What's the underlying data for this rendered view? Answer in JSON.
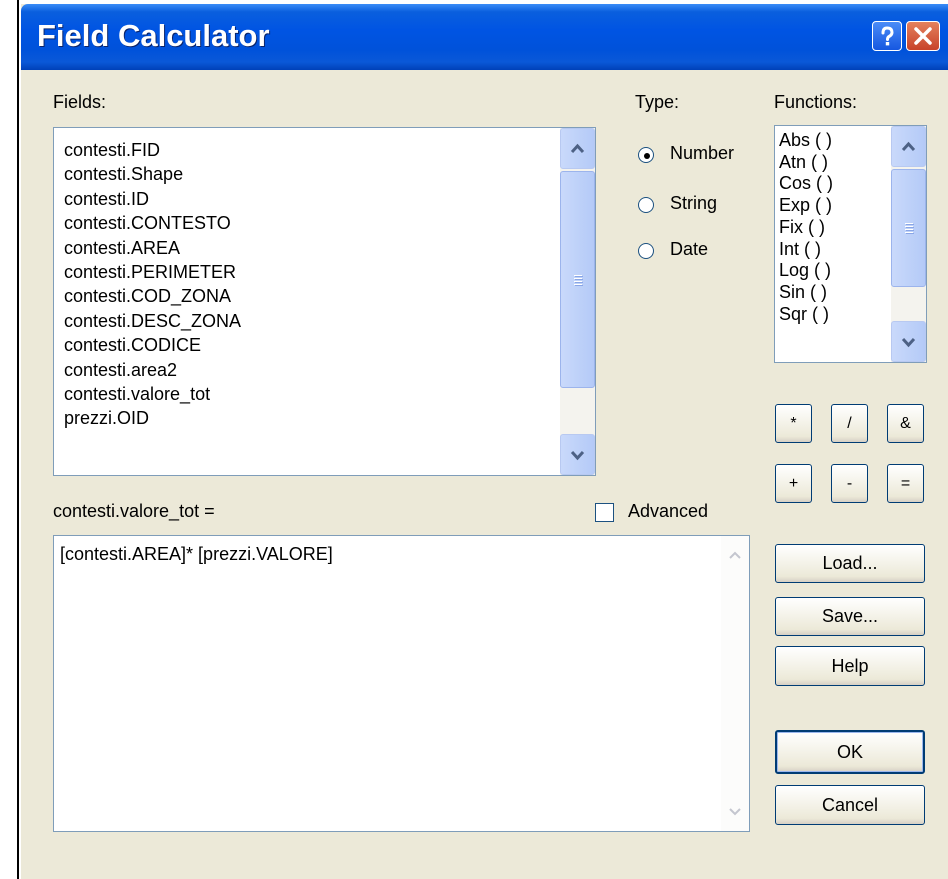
{
  "window": {
    "title": "Field Calculator"
  },
  "fields": {
    "label": "Fields:",
    "items": [
      "contesti.FID",
      "contesti.Shape",
      "contesti.ID",
      "contesti.CONTESTO",
      "contesti.AREA",
      "contesti.PERIMETER",
      "contesti.COD_ZONA",
      "contesti.DESC_ZONA",
      "contesti.CODICE",
      "contesti.area2",
      "contesti.valore_tot",
      "prezzi.OID"
    ]
  },
  "type": {
    "label": "Type:",
    "options": [
      "Number",
      "String",
      "Date"
    ],
    "selected": "Number"
  },
  "functions": {
    "label": "Functions:",
    "items": [
      "Abs ( )",
      "Atn ( )",
      "Cos ( )",
      "Exp ( )",
      "Fix ( )",
      "Int ( )",
      "Log ( )",
      "Sin ( )",
      "Sqr ( )"
    ]
  },
  "operators": [
    "*",
    "/",
    "&",
    "+",
    "-",
    "="
  ],
  "expression": {
    "label": "contesti.valore_tot =",
    "value": "[contesti.AREA]* [prezzi.VALORE]"
  },
  "advanced": {
    "label": "Advanced",
    "checked": false
  },
  "buttons": {
    "load": "Load...",
    "save": "Save...",
    "help": "Help",
    "ok": "OK",
    "cancel": "Cancel"
  },
  "colors": {
    "titlebar": "#0054e3",
    "dialog": "#ece9d8",
    "border": "#7f9db9"
  }
}
